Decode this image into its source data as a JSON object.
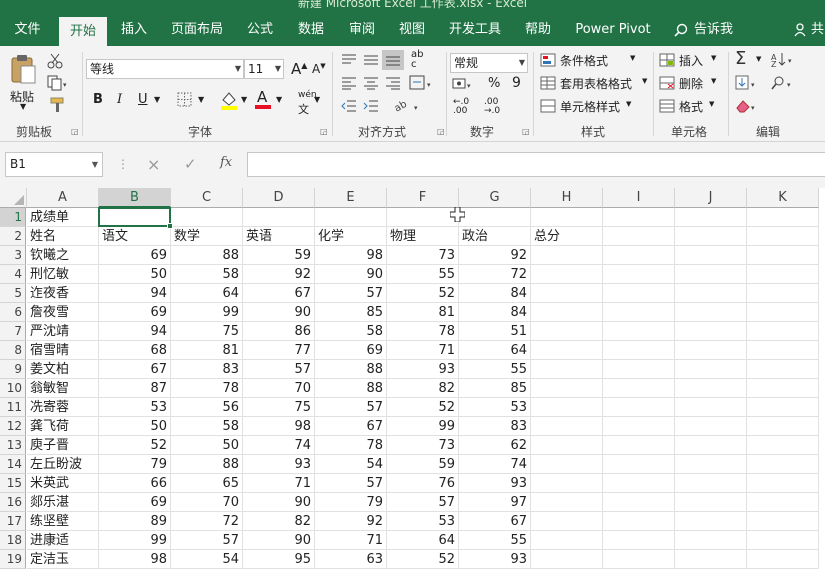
{
  "window": {
    "title": "新建 Microsoft Excel 工作表.xlsx  -  Excel"
  },
  "tabs": [
    {
      "label": "文件",
      "active": false
    },
    {
      "label": "开始",
      "active": true
    },
    {
      "label": "插入",
      "active": false
    },
    {
      "label": "页面布局",
      "active": false
    },
    {
      "label": "公式",
      "active": false
    },
    {
      "label": "数据",
      "active": false
    },
    {
      "label": "审阅",
      "active": false
    },
    {
      "label": "视图",
      "active": false
    },
    {
      "label": "开发工具",
      "active": false
    },
    {
      "label": "帮助",
      "active": false
    },
    {
      "label": "Power Pivot",
      "active": false
    }
  ],
  "tellme": {
    "label": "告诉我"
  },
  "share": {
    "label": "共"
  },
  "ribbon": {
    "clipboard": {
      "group": "剪贴板",
      "paste": "粘贴"
    },
    "font": {
      "group": "字体",
      "name": "等线",
      "size": "11",
      "bold": "B",
      "italic": "I",
      "underline": "U",
      "grow": "A",
      "shrink": "A",
      "font_color_letter": "A",
      "phonetic": "wén"
    },
    "alignment": {
      "group": "对齐方式"
    },
    "number": {
      "group": "数字",
      "format": "常规",
      "percent": "%",
      "comma": "9"
    },
    "styles": {
      "group": "样式",
      "conditional": "条件格式",
      "table": "套用表格格式",
      "cell_styles": "单元格样式"
    },
    "cells": {
      "group": "单元格",
      "insert": "插入",
      "delete": "删除",
      "format": "格式"
    },
    "editing": {
      "group": "编辑"
    }
  },
  "formula_bar": {
    "name_box": "B1",
    "cancel": "×",
    "enter": "✓",
    "fx": "fx",
    "value": ""
  },
  "sheet": {
    "columns": [
      "A",
      "B",
      "C",
      "D",
      "E",
      "F",
      "G",
      "H",
      "I",
      "J",
      "K"
    ],
    "selected_col": "B",
    "selected_row": 1,
    "rows": [
      {
        "n": "1",
        "cells": [
          "成绩单",
          "",
          "",
          "",
          "",
          "",
          "",
          "",
          "",
          "",
          ""
        ]
      },
      {
        "n": "2",
        "cells": [
          "姓名",
          "语文",
          "数学",
          "英语",
          "化学",
          "物理",
          "政治",
          "总分",
          "",
          "",
          ""
        ]
      },
      {
        "n": "3",
        "cells": [
          "钦曦之",
          "69",
          "88",
          "59",
          "98",
          "73",
          "92",
          "",
          "",
          "",
          ""
        ]
      },
      {
        "n": "4",
        "cells": [
          "刑忆敏",
          "50",
          "58",
          "92",
          "90",
          "55",
          "72",
          "",
          "",
          "",
          ""
        ]
      },
      {
        "n": "5",
        "cells": [
          "迮夜香",
          "94",
          "64",
          "67",
          "57",
          "52",
          "84",
          "",
          "",
          "",
          ""
        ]
      },
      {
        "n": "6",
        "cells": [
          "詹夜雪",
          "69",
          "99",
          "90",
          "85",
          "81",
          "84",
          "",
          "",
          "",
          ""
        ]
      },
      {
        "n": "7",
        "cells": [
          "严沈靖",
          "94",
          "75",
          "86",
          "58",
          "78",
          "51",
          "",
          "",
          "",
          ""
        ]
      },
      {
        "n": "8",
        "cells": [
          "宿雪晴",
          "68",
          "81",
          "77",
          "69",
          "71",
          "64",
          "",
          "",
          "",
          ""
        ]
      },
      {
        "n": "9",
        "cells": [
          "姜文柏",
          "67",
          "83",
          "57",
          "88",
          "93",
          "55",
          "",
          "",
          "",
          ""
        ]
      },
      {
        "n": "10",
        "cells": [
          "翁敏智",
          "87",
          "78",
          "70",
          "88",
          "82",
          "85",
          "",
          "",
          "",
          ""
        ]
      },
      {
        "n": "11",
        "cells": [
          "冼寄蓉",
          "53",
          "56",
          "75",
          "57",
          "52",
          "53",
          "",
          "",
          "",
          ""
        ]
      },
      {
        "n": "12",
        "cells": [
          "龚飞荷",
          "50",
          "58",
          "98",
          "67",
          "99",
          "83",
          "",
          "",
          "",
          ""
        ]
      },
      {
        "n": "13",
        "cells": [
          "庾子晋",
          "52",
          "50",
          "74",
          "78",
          "73",
          "62",
          "",
          "",
          "",
          ""
        ]
      },
      {
        "n": "14",
        "cells": [
          "左丘盼波",
          "79",
          "88",
          "93",
          "54",
          "59",
          "74",
          "",
          "",
          "",
          ""
        ]
      },
      {
        "n": "15",
        "cells": [
          "米英武",
          "66",
          "65",
          "71",
          "57",
          "76",
          "93",
          "",
          "",
          "",
          ""
        ]
      },
      {
        "n": "16",
        "cells": [
          "郯乐湛",
          "69",
          "70",
          "90",
          "79",
          "57",
          "97",
          "",
          "",
          "",
          ""
        ]
      },
      {
        "n": "17",
        "cells": [
          "练坚壁",
          "89",
          "72",
          "82",
          "92",
          "53",
          "67",
          "",
          "",
          "",
          ""
        ]
      },
      {
        "n": "18",
        "cells": [
          "进康适",
          "99",
          "57",
          "90",
          "71",
          "64",
          "55",
          "",
          "",
          "",
          ""
        ]
      },
      {
        "n": "19",
        "cells": [
          "定洁玉",
          "98",
          "54",
          "95",
          "63",
          "52",
          "93",
          "",
          "",
          "",
          ""
        ]
      }
    ]
  },
  "colors": {
    "accent": "#217346",
    "font_red": "#e81123",
    "fill_yellow": "#ffff00"
  }
}
